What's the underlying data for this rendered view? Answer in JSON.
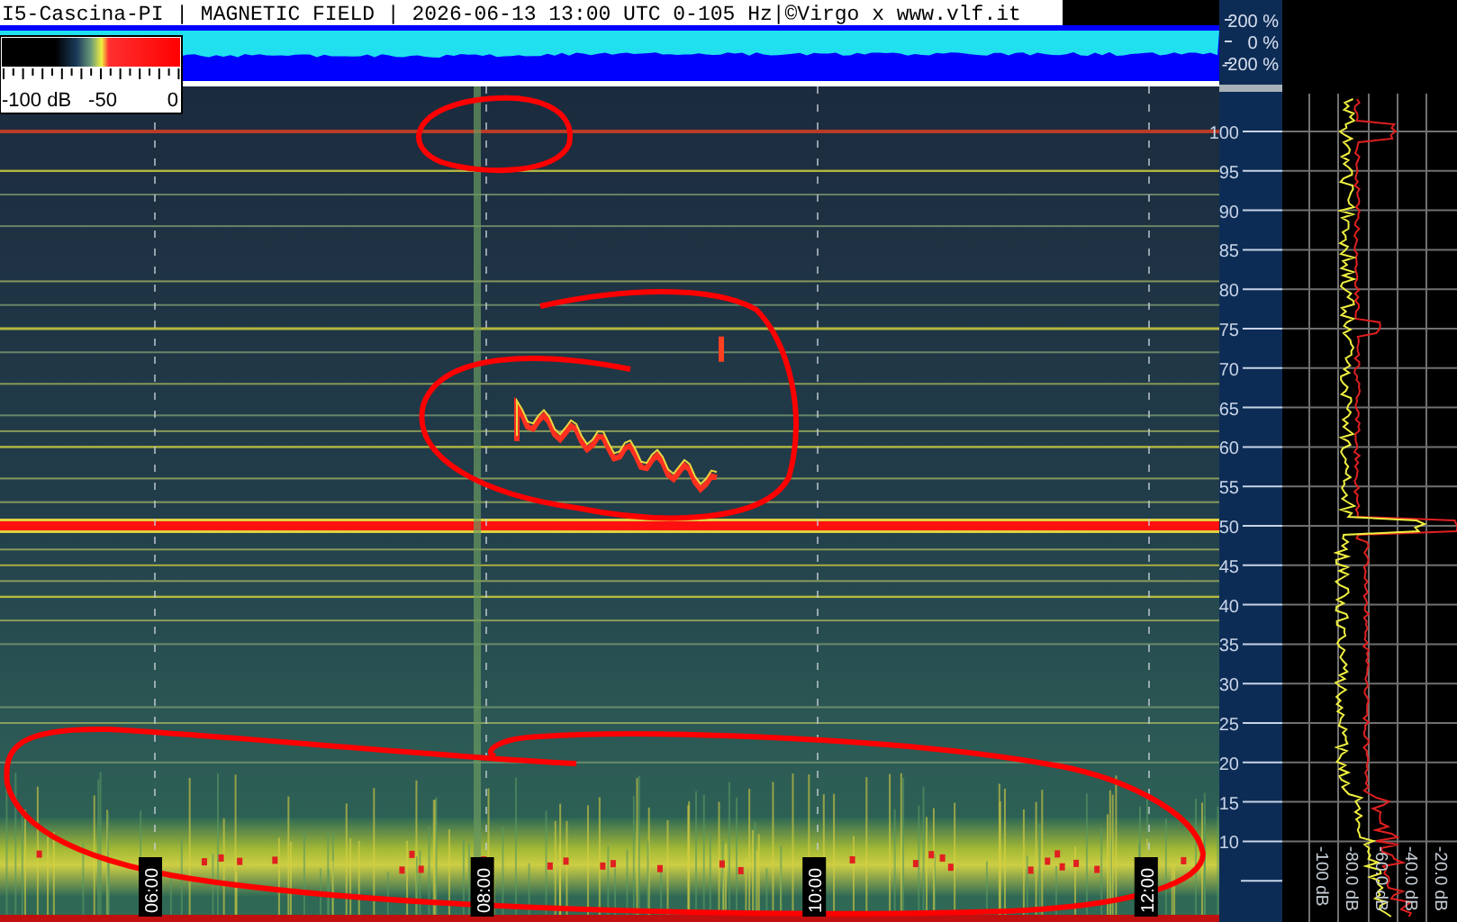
{
  "header": {
    "title": "I5-Cascina-PI | MAGNETIC FIELD | 2026-06-13 13:00 UTC 0-105 Hz|©Virgo x www.vlf.it"
  },
  "color_scale": {
    "labels": [
      "-100 dB",
      "-50",
      "0"
    ]
  },
  "amplitude_axis": {
    "labels": [
      "200 %",
      "0 %",
      "-200 %"
    ]
  },
  "frequency_axis": {
    "labels": [
      "100",
      "95",
      "90",
      "85",
      "80",
      "75",
      "70",
      "65",
      "60",
      "55",
      "50",
      "45",
      "40",
      "35",
      "30",
      "25",
      "20",
      "15",
      "10"
    ]
  },
  "time_axis": {
    "labels": [
      "06:00",
      "08:00",
      "10:00",
      "12:00"
    ]
  },
  "spectrum_axis": {
    "labels": [
      "-100 dB",
      "-80.0 dB",
      "-60.0 dB",
      "-40.0 dB",
      "-20.0 dB"
    ]
  }
}
